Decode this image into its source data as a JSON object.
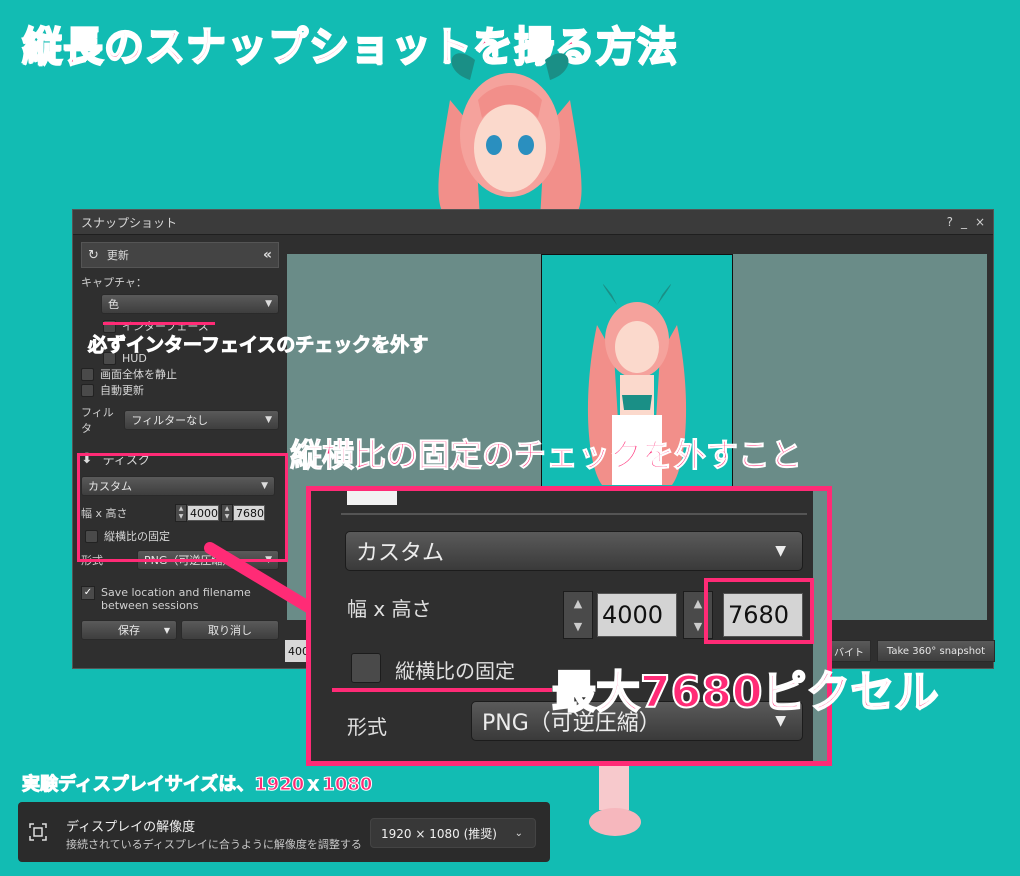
{
  "headline": "縦長のスナップショットを撮る方法",
  "window": {
    "title": "スナップショット",
    "controls": [
      "?",
      "_",
      "×"
    ],
    "refresh_label": "更新",
    "collapse_glyph": "«",
    "capture_label": "キャプチャ：",
    "capture_value": "色",
    "checkboxes": {
      "interface": "インターフェース",
      "hud_hidden": "",
      "hud": "HUD",
      "freeze": "画面全体を静止",
      "auto": "自動更新"
    },
    "filter_label": "フィルタ",
    "filter_value": "フィルターなし",
    "disk_label": "ディスク",
    "size_preset": "カスタム",
    "size_label": "幅 x 高さ",
    "width": "4000",
    "height": "7680",
    "lock_ratio": "縦横比の固定",
    "format_label": "形式",
    "format_value": "PNG（可逆圧縮）",
    "save_location": "Save location and filename between sessions",
    "save_button": "保存",
    "cancel_button": "取り消し",
    "bottom_left_value": "400",
    "bottom_mid": "バイト",
    "bottom_right": "Take 360° snapshot"
  },
  "annotations": {
    "interface_note": "必ずインターフェイスのチェックを外す",
    "ratio_note": "縦横比の固定のチェックを外すこと",
    "max_note": "最大7680ピクセル",
    "display_note": "実験ディスプレイサイズは、1920ｘ1080"
  },
  "zoom": {
    "size_preset": "カスタム",
    "size_label": "幅 x 高さ",
    "width": "4000",
    "height": "7680",
    "lock_ratio": "縦横比の固定",
    "format_label": "形式",
    "format_value": "PNG（可逆圧縮）"
  },
  "display_setting": {
    "title": "ディスプレイの解像度",
    "subtitle": "接続されているディスプレイに合うように解像度を調整する",
    "value": "1920 × 1080 (推奨)"
  },
  "colors": {
    "background": "#12bcb3",
    "accent": "#ff2b76",
    "window": "#2f2f2f",
    "preview": "#6a8c88"
  }
}
